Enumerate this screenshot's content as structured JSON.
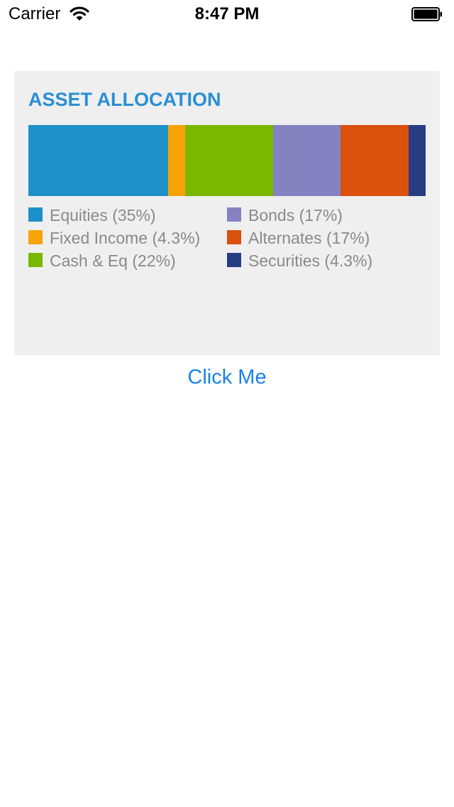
{
  "status_bar": {
    "carrier": "Carrier",
    "time": "8:47 PM"
  },
  "card": {
    "title": "ASSET ALLOCATION"
  },
  "chart_data": {
    "type": "bar",
    "title": "ASSET ALLOCATION",
    "stacked": true,
    "orientation": "horizontal",
    "categories": [
      "Equities",
      "Fixed Income",
      "Cash & Eq",
      "Bonds",
      "Alternates",
      "Securities"
    ],
    "values": [
      35,
      4.3,
      22,
      17,
      17,
      4.3
    ],
    "colors": [
      "#1e90c8",
      "#f8a308",
      "#7ab800",
      "#8482c0",
      "#da510c",
      "#263d84"
    ],
    "legend": [
      {
        "label": "Equities (35%)",
        "color": "#1e90c8",
        "column": 0,
        "row": 0
      },
      {
        "label": "Fixed Income (4.3%)",
        "color": "#f8a308",
        "column": 0,
        "row": 1
      },
      {
        "label": "Cash & Eq (22%)",
        "color": "#7ab800",
        "column": 0,
        "row": 2
      },
      {
        "label": "Bonds (17%)",
        "color": "#8482c0",
        "column": 1,
        "row": 0
      },
      {
        "label": "Alternates (17%)",
        "color": "#da510c",
        "column": 1,
        "row": 1
      },
      {
        "label": "Securities (4.3%)",
        "color": "#263d84",
        "column": 1,
        "row": 2
      }
    ],
    "legend_placement": "bottom"
  },
  "button": {
    "label": "Click Me"
  }
}
